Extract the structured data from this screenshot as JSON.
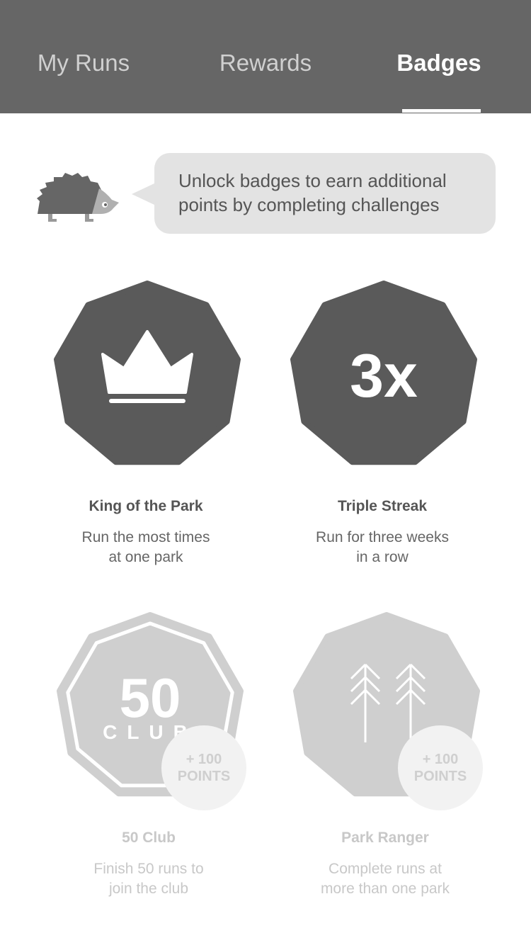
{
  "tabs": [
    {
      "label": "My Runs"
    },
    {
      "label": "Rewards"
    },
    {
      "label": "Badges",
      "active": true
    }
  ],
  "intro": {
    "line1": "Unlock badges to earn additional",
    "line2": "points by completing challenges"
  },
  "badges": [
    {
      "title": "King of the Park",
      "desc1": "Run the most times",
      "desc2": "at one park",
      "icon": "crown-icon",
      "unlocked": true
    },
    {
      "title": "Triple Streak",
      "desc1": "Run for three weeks",
      "desc2": "in a row",
      "icon_text": "3x",
      "unlocked": true
    },
    {
      "title": "50 Club",
      "desc1": "Finish 50 runs to",
      "desc2": "join the club",
      "icon_text": "50",
      "icon_subtext": "CLUB",
      "reward_line1": "+ 100",
      "reward_line2": "POINTS",
      "unlocked": false
    },
    {
      "title": "Park Ranger",
      "desc1": "Complete runs at",
      "desc2": "more than one park",
      "icon": "trees-icon",
      "reward_line1": "+ 100",
      "reward_line2": "POINTS",
      "unlocked": false
    }
  ],
  "colors": {
    "header": "#666666",
    "badge_dark": "#5a5a5a",
    "badge_light": "#cfcfcf",
    "points_circle": "#f2f2f2"
  }
}
